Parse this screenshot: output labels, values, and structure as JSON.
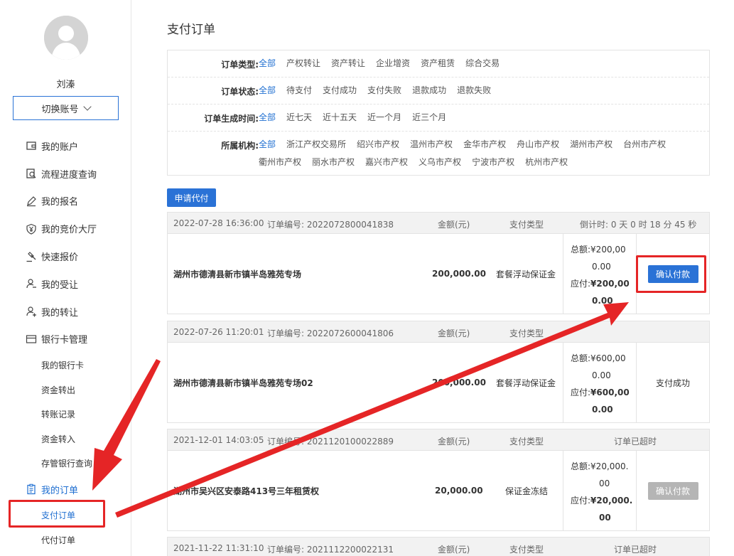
{
  "user": {
    "name": "刘溱",
    "switch_label": "切换账号"
  },
  "menu": {
    "items": [
      {
        "label": "我的账户",
        "icon": "wallet-icon"
      },
      {
        "label": "流程进度查询",
        "icon": "search-doc-icon"
      },
      {
        "label": "我的报名",
        "icon": "pen-icon"
      },
      {
        "label": "我的竞价大厅",
        "icon": "yen-icon"
      },
      {
        "label": "快速报价",
        "icon": "gavel-icon"
      },
      {
        "label": "我的受让",
        "icon": "user-minus-icon"
      },
      {
        "label": "我的转让",
        "icon": "user-plus-icon"
      },
      {
        "label": "银行卡管理",
        "icon": "card-icon"
      }
    ],
    "bank_sub": [
      "我的银行卡",
      "资金转出",
      "转账记录",
      "资金转入",
      "存管银行查询"
    ],
    "orders": {
      "label": "我的订单",
      "icon": "clipboard-icon"
    },
    "orders_sub": [
      "支付订单",
      "代付订单"
    ]
  },
  "page": {
    "title": "支付订单",
    "apply_label": "申请代付"
  },
  "filters": {
    "type": {
      "label": "订单类型:",
      "options": [
        "全部",
        "产权转让",
        "资产转让",
        "企业增资",
        "资产租赁",
        "综合交易"
      ]
    },
    "status": {
      "label": "订单状态:",
      "options": [
        "全部",
        "待支付",
        "支付成功",
        "支付失败",
        "退款成功",
        "退款失败"
      ]
    },
    "time": {
      "label": "订单生成时间:",
      "options": [
        "全部",
        "近七天",
        "近十五天",
        "近一个月",
        "近三个月"
      ]
    },
    "org": {
      "label": "所属机构:",
      "options": [
        "全部",
        "浙江产权交易所",
        "绍兴市产权",
        "温州市产权",
        "金华市产权",
        "舟山市产权",
        "湖州市产权",
        "台州市产权",
        "衢州市产权",
        "丽水市产权",
        "嘉兴市产权",
        "义乌市产权",
        "宁波市产权",
        "杭州市产权"
      ]
    }
  },
  "orders": [
    {
      "date": "2022-07-28  16:36:00",
      "no": "订单编号:  2022072800041838",
      "amt_h": "金额(元)",
      "type_h": "支付类型",
      "right_h": "倒计时:  0 天 0 时 18 分 45 秒",
      "name": "湖州市德清县新市镇半岛雅苑专场",
      "amount": "200,000.00",
      "pay_type": "套餐浮动保证金",
      "total_label": "总额:",
      "total_a": "¥200,00",
      "total_b": "0.00",
      "due_label": "应付:",
      "due_a": "¥200,00",
      "due_b": "0.00",
      "action": "确认付款"
    },
    {
      "date": "2022-07-26  11:20:01",
      "no": "订单编号:  2022072600041806",
      "amt_h": "金额(元)",
      "type_h": "支付类型",
      "right_h": "",
      "name": "湖州市德清县新市镇半岛雅苑专场02",
      "amount": "200,000.00",
      "pay_type": "套餐浮动保证金",
      "total_label": "总额:",
      "total_a": "¥600,00",
      "total_b": "0.00",
      "due_label": "应付:",
      "due_a": "¥600,00",
      "due_b": "0.00",
      "action": "支付成功"
    },
    {
      "date": "2021-12-01  14:03:05",
      "no": "订单编号:  2021120100022889",
      "amt_h": "金额(元)",
      "type_h": "支付类型",
      "right_h": "订单已超时",
      "name": "湖州市吴兴区安泰路413号三年租赁权",
      "amount": "20,000.00",
      "pay_type": "保证金冻结",
      "total_label": "总额:",
      "total_a": "¥20,000.",
      "total_b": "00",
      "due_label": "应付:",
      "due_a": "¥20,000.",
      "due_b": "00",
      "action": "确认付款"
    },
    {
      "date": "2021-11-22  11:31:10",
      "no": "订单编号:  2021112200022131",
      "amt_h": "金额(元)",
      "type_h": "支付类型",
      "right_h": "订单已超时"
    }
  ],
  "colors": {
    "accent": "#2a72d6",
    "annotation": "#e52526"
  }
}
